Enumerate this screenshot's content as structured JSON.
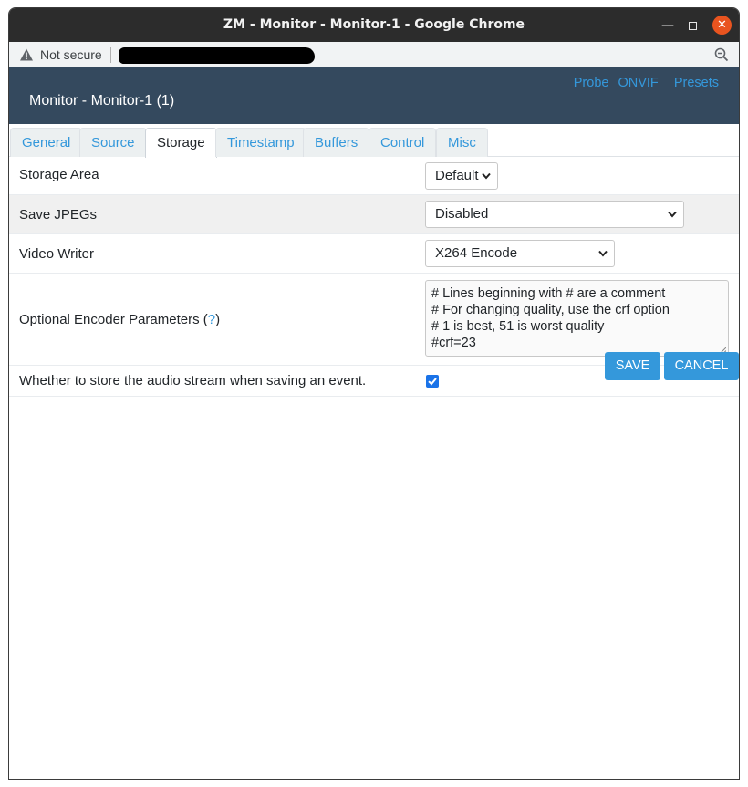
{
  "window": {
    "title": "ZM - Monitor - Monitor-1 - Google Chrome"
  },
  "urlbar": {
    "security_text": "Not secure"
  },
  "header": {
    "title": "Monitor - Monitor-1 (1)",
    "links": [
      "Probe",
      "ONVIF",
      "Presets"
    ]
  },
  "tabs": [
    {
      "label": "General",
      "active": false
    },
    {
      "label": "Source",
      "active": false
    },
    {
      "label": "Storage",
      "active": true
    },
    {
      "label": "Timestamp",
      "active": false
    },
    {
      "label": "Buffers",
      "active": false
    },
    {
      "label": "Control",
      "active": false
    },
    {
      "label": "Misc",
      "active": false
    }
  ],
  "form": {
    "storage_area": {
      "label": "Storage Area",
      "value": "Default"
    },
    "save_jpegs": {
      "label": "Save JPEGs",
      "value": "Disabled"
    },
    "video_writer": {
      "label": "Video Writer",
      "value": "X264 Encode"
    },
    "encoder_params": {
      "label": "Optional Encoder Parameters (",
      "help": "?",
      "label_end": ")",
      "lines": [
        "# Lines beginning with # are a comment",
        "# For changing quality, use the crf option",
        "# 1 is best, 51 is worst quality",
        "#crf=23"
      ]
    },
    "record_audio": {
      "label": "Whether to store the audio stream when saving an event.",
      "checked": true
    }
  },
  "buttons": {
    "save": "SAVE",
    "cancel": "CANCEL"
  },
  "colors": {
    "header_bg": "#34495e",
    "accent": "#3498db",
    "close_button": "#e9541f"
  },
  "icons": [
    "warning-icon",
    "zoom-icon",
    "minimize-icon",
    "maximize-icon",
    "close-icon",
    "chevron-down-icon",
    "check-icon"
  ]
}
